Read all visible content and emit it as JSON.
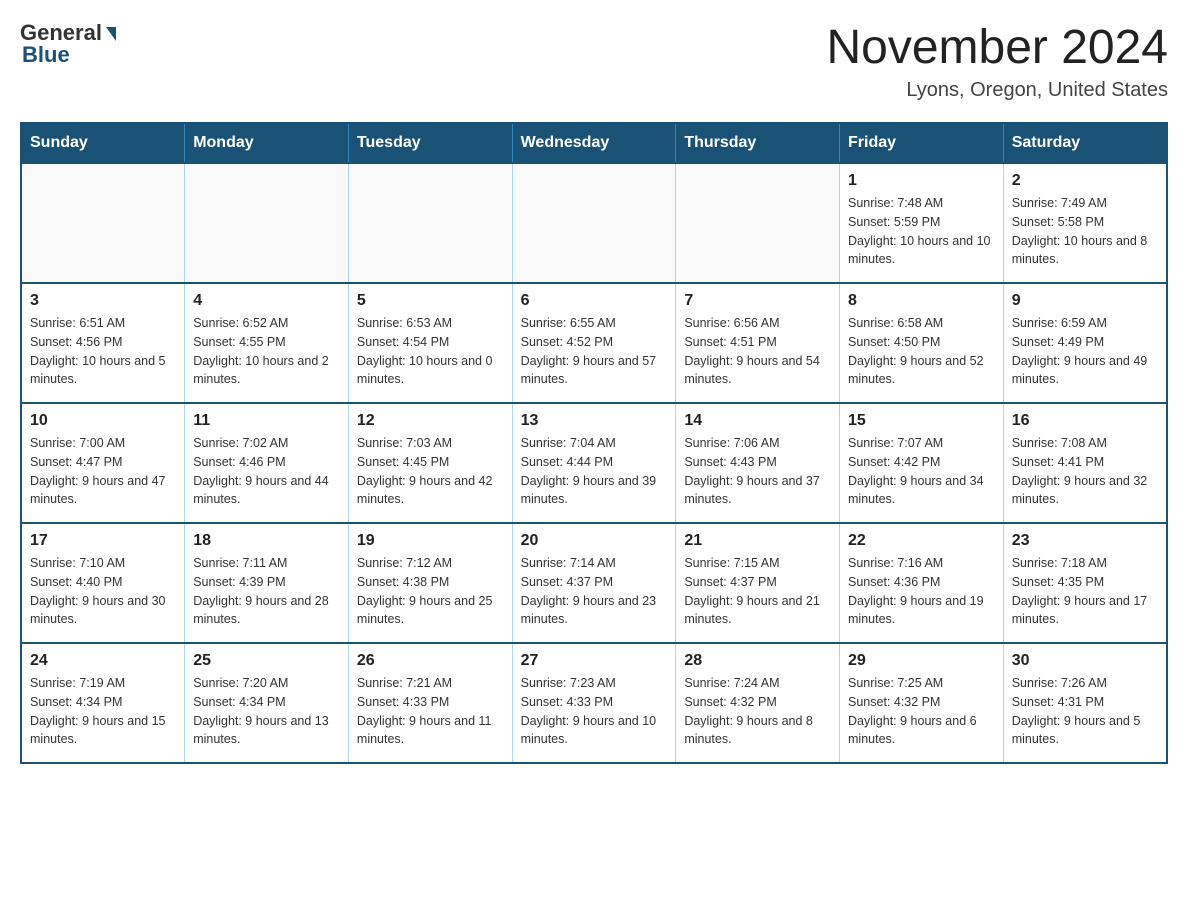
{
  "header": {
    "logo": {
      "general": "General",
      "blue": "Blue"
    },
    "title": "November 2024",
    "location": "Lyons, Oregon, United States"
  },
  "calendar": {
    "days_of_week": [
      "Sunday",
      "Monday",
      "Tuesday",
      "Wednesday",
      "Thursday",
      "Friday",
      "Saturday"
    ],
    "weeks": [
      [
        {
          "day": "",
          "info": ""
        },
        {
          "day": "",
          "info": ""
        },
        {
          "day": "",
          "info": ""
        },
        {
          "day": "",
          "info": ""
        },
        {
          "day": "",
          "info": ""
        },
        {
          "day": "1",
          "info": "Sunrise: 7:48 AM\nSunset: 5:59 PM\nDaylight: 10 hours and 10 minutes."
        },
        {
          "day": "2",
          "info": "Sunrise: 7:49 AM\nSunset: 5:58 PM\nDaylight: 10 hours and 8 minutes."
        }
      ],
      [
        {
          "day": "3",
          "info": "Sunrise: 6:51 AM\nSunset: 4:56 PM\nDaylight: 10 hours and 5 minutes."
        },
        {
          "day": "4",
          "info": "Sunrise: 6:52 AM\nSunset: 4:55 PM\nDaylight: 10 hours and 2 minutes."
        },
        {
          "day": "5",
          "info": "Sunrise: 6:53 AM\nSunset: 4:54 PM\nDaylight: 10 hours and 0 minutes."
        },
        {
          "day": "6",
          "info": "Sunrise: 6:55 AM\nSunset: 4:52 PM\nDaylight: 9 hours and 57 minutes."
        },
        {
          "day": "7",
          "info": "Sunrise: 6:56 AM\nSunset: 4:51 PM\nDaylight: 9 hours and 54 minutes."
        },
        {
          "day": "8",
          "info": "Sunrise: 6:58 AM\nSunset: 4:50 PM\nDaylight: 9 hours and 52 minutes."
        },
        {
          "day": "9",
          "info": "Sunrise: 6:59 AM\nSunset: 4:49 PM\nDaylight: 9 hours and 49 minutes."
        }
      ],
      [
        {
          "day": "10",
          "info": "Sunrise: 7:00 AM\nSunset: 4:47 PM\nDaylight: 9 hours and 47 minutes."
        },
        {
          "day": "11",
          "info": "Sunrise: 7:02 AM\nSunset: 4:46 PM\nDaylight: 9 hours and 44 minutes."
        },
        {
          "day": "12",
          "info": "Sunrise: 7:03 AM\nSunset: 4:45 PM\nDaylight: 9 hours and 42 minutes."
        },
        {
          "day": "13",
          "info": "Sunrise: 7:04 AM\nSunset: 4:44 PM\nDaylight: 9 hours and 39 minutes."
        },
        {
          "day": "14",
          "info": "Sunrise: 7:06 AM\nSunset: 4:43 PM\nDaylight: 9 hours and 37 minutes."
        },
        {
          "day": "15",
          "info": "Sunrise: 7:07 AM\nSunset: 4:42 PM\nDaylight: 9 hours and 34 minutes."
        },
        {
          "day": "16",
          "info": "Sunrise: 7:08 AM\nSunset: 4:41 PM\nDaylight: 9 hours and 32 minutes."
        }
      ],
      [
        {
          "day": "17",
          "info": "Sunrise: 7:10 AM\nSunset: 4:40 PM\nDaylight: 9 hours and 30 minutes."
        },
        {
          "day": "18",
          "info": "Sunrise: 7:11 AM\nSunset: 4:39 PM\nDaylight: 9 hours and 28 minutes."
        },
        {
          "day": "19",
          "info": "Sunrise: 7:12 AM\nSunset: 4:38 PM\nDaylight: 9 hours and 25 minutes."
        },
        {
          "day": "20",
          "info": "Sunrise: 7:14 AM\nSunset: 4:37 PM\nDaylight: 9 hours and 23 minutes."
        },
        {
          "day": "21",
          "info": "Sunrise: 7:15 AM\nSunset: 4:37 PM\nDaylight: 9 hours and 21 minutes."
        },
        {
          "day": "22",
          "info": "Sunrise: 7:16 AM\nSunset: 4:36 PM\nDaylight: 9 hours and 19 minutes."
        },
        {
          "day": "23",
          "info": "Sunrise: 7:18 AM\nSunset: 4:35 PM\nDaylight: 9 hours and 17 minutes."
        }
      ],
      [
        {
          "day": "24",
          "info": "Sunrise: 7:19 AM\nSunset: 4:34 PM\nDaylight: 9 hours and 15 minutes."
        },
        {
          "day": "25",
          "info": "Sunrise: 7:20 AM\nSunset: 4:34 PM\nDaylight: 9 hours and 13 minutes."
        },
        {
          "day": "26",
          "info": "Sunrise: 7:21 AM\nSunset: 4:33 PM\nDaylight: 9 hours and 11 minutes."
        },
        {
          "day": "27",
          "info": "Sunrise: 7:23 AM\nSunset: 4:33 PM\nDaylight: 9 hours and 10 minutes."
        },
        {
          "day": "28",
          "info": "Sunrise: 7:24 AM\nSunset: 4:32 PM\nDaylight: 9 hours and 8 minutes."
        },
        {
          "day": "29",
          "info": "Sunrise: 7:25 AM\nSunset: 4:32 PM\nDaylight: 9 hours and 6 minutes."
        },
        {
          "day": "30",
          "info": "Sunrise: 7:26 AM\nSunset: 4:31 PM\nDaylight: 9 hours and 5 minutes."
        }
      ]
    ]
  }
}
